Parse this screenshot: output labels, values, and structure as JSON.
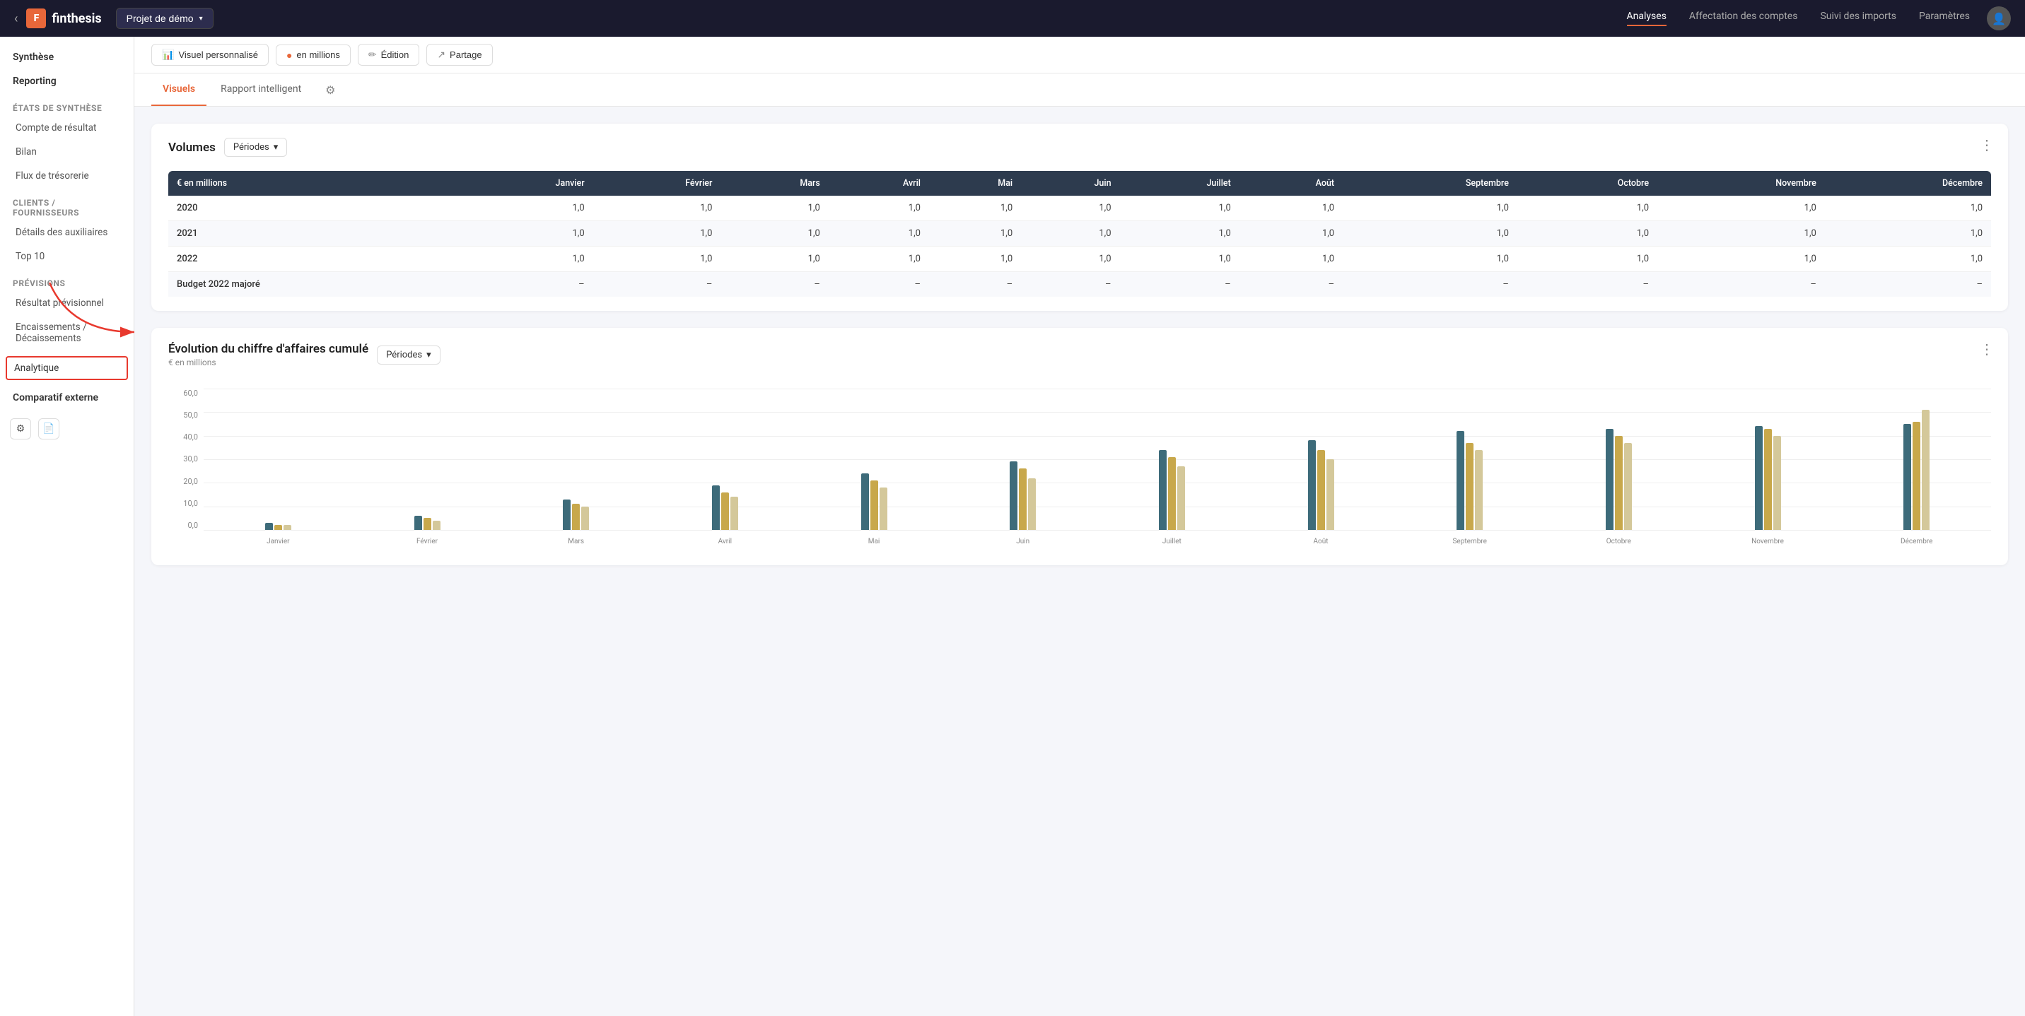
{
  "app": {
    "logo_text": "F",
    "name": "finthesis",
    "project": "Projet de démo",
    "project_arrow": "▾"
  },
  "topnav": {
    "links": [
      {
        "label": "Analyses",
        "active": true
      },
      {
        "label": "Affectation des comptes",
        "active": false
      },
      {
        "label": "Suivi des imports",
        "active": false
      },
      {
        "label": "Paramètres",
        "active": false
      }
    ]
  },
  "sidebar": {
    "items": [
      {
        "label": "Synthèse",
        "type": "top-level",
        "active": false
      },
      {
        "label": "Reporting",
        "type": "top-level",
        "active": false
      },
      {
        "label": "États de synthèse",
        "type": "section",
        "active": false
      },
      {
        "label": "Compte de résultat",
        "type": "sub",
        "active": false
      },
      {
        "label": "Bilan",
        "type": "sub",
        "active": false
      },
      {
        "label": "Flux de trésorerie",
        "type": "sub",
        "active": false
      },
      {
        "label": "Clients / Fournisseurs",
        "type": "section",
        "active": false
      },
      {
        "label": "Détails des auxiliaires",
        "type": "sub",
        "active": false
      },
      {
        "label": "Top 10",
        "type": "sub",
        "active": false
      },
      {
        "label": "Prévisions",
        "type": "section",
        "active": false
      },
      {
        "label": "Résultat prévisionnel",
        "type": "sub",
        "active": false
      },
      {
        "label": "Encaissements / Décaissements",
        "type": "sub",
        "active": false
      },
      {
        "label": "Analytique",
        "type": "highlighted",
        "active": true
      },
      {
        "label": "Comparatif externe",
        "type": "top-level",
        "active": false
      }
    ],
    "footer_icons": [
      "⚙",
      "📄"
    ]
  },
  "toolbar": {
    "buttons": [
      {
        "icon": "📊",
        "label": "Visuel personnalisé"
      },
      {
        "icon": "●",
        "label": "en millions"
      },
      {
        "icon": "✏",
        "label": "Édition"
      },
      {
        "icon": "↗",
        "label": "Partage"
      }
    ]
  },
  "tabs": {
    "items": [
      {
        "label": "Visuels",
        "active": true
      },
      {
        "label": "Rapport intelligent",
        "active": false
      }
    ],
    "gear_label": "⚙"
  },
  "volumes_section": {
    "title": "Volumes",
    "period_label": "Périodes",
    "more_icon": "⋮",
    "table": {
      "columns": [
        "€ en millions",
        "Janvier",
        "Février",
        "Mars",
        "Avril",
        "Mai",
        "Juin",
        "Juillet",
        "Août",
        "Septembre",
        "Octobre",
        "Novembre",
        "Décembre"
      ],
      "rows": [
        {
          "label": "2020",
          "values": [
            "1,0",
            "1,0",
            "1,0",
            "1,0",
            "1,0",
            "1,0",
            "1,0",
            "1,0",
            "1,0",
            "1,0",
            "1,0",
            "1,0"
          ]
        },
        {
          "label": "2021",
          "values": [
            "1,0",
            "1,0",
            "1,0",
            "1,0",
            "1,0",
            "1,0",
            "1,0",
            "1,0",
            "1,0",
            "1,0",
            "1,0",
            "1,0"
          ]
        },
        {
          "label": "2022",
          "values": [
            "1,0",
            "1,0",
            "1,0",
            "1,0",
            "1,0",
            "1,0",
            "1,0",
            "1,0",
            "1,0",
            "1,0",
            "1,0",
            "1,0"
          ]
        },
        {
          "label": "Budget 2022 majoré",
          "values": [
            "–",
            "–",
            "–",
            "–",
            "–",
            "–",
            "–",
            "–",
            "–",
            "–",
            "–",
            "–"
          ]
        }
      ]
    }
  },
  "evolution_section": {
    "title": "Évolution du chiffre d'affaires cumulé",
    "subtitle": "€ en millions",
    "period_label": "Périodes",
    "more_icon": "⋮",
    "y_labels": [
      "0,0",
      "10,0",
      "20,0",
      "30,0",
      "40,0",
      "50,0",
      "60,0"
    ],
    "months": [
      "Janvier",
      "Février",
      "Mars",
      "Avril",
      "Mai",
      "Juin",
      "Juillet",
      "Août",
      "Septembre",
      "Octobre",
      "Novembre",
      "Décembre"
    ],
    "series": {
      "dark_teal": [
        3,
        6,
        13,
        19,
        24,
        29,
        34,
        38,
        42,
        43,
        44,
        45
      ],
      "gold": [
        2,
        5,
        11,
        16,
        21,
        26,
        31,
        34,
        37,
        40,
        43,
        46
      ],
      "light_tan": [
        2,
        4,
        10,
        14,
        18,
        22,
        27,
        30,
        34,
        37,
        40,
        51
      ]
    },
    "max_value": 60
  }
}
